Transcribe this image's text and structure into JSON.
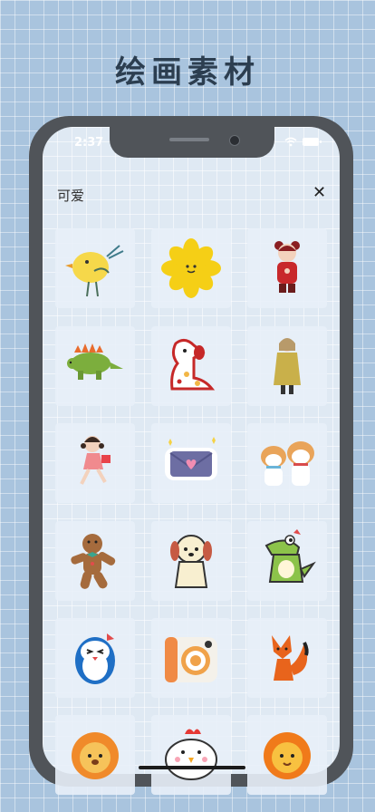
{
  "headline": "绘画素材",
  "status_bar": {
    "time": "2:37"
  },
  "panel": {
    "title": "可爱",
    "close_glyph": "✕"
  },
  "stickers": [
    "bird",
    "yellow-flower",
    "girl-in-red",
    "stegosaurus",
    "puppy-with-spots",
    "girl-in-raincoat",
    "running-girl-with-gift",
    "love-letter-envelope",
    "two-shiba-dogs",
    "gingerbread-man",
    "cream-puppy",
    "green-dinosaur",
    "penguin",
    "camera",
    "fox",
    "lion",
    "chicken",
    "lion-face"
  ],
  "colors": {
    "background": "#a9c4de",
    "phone_frame": "#505459",
    "screen": "#dfe9f3",
    "headline": "#2c3e50"
  }
}
